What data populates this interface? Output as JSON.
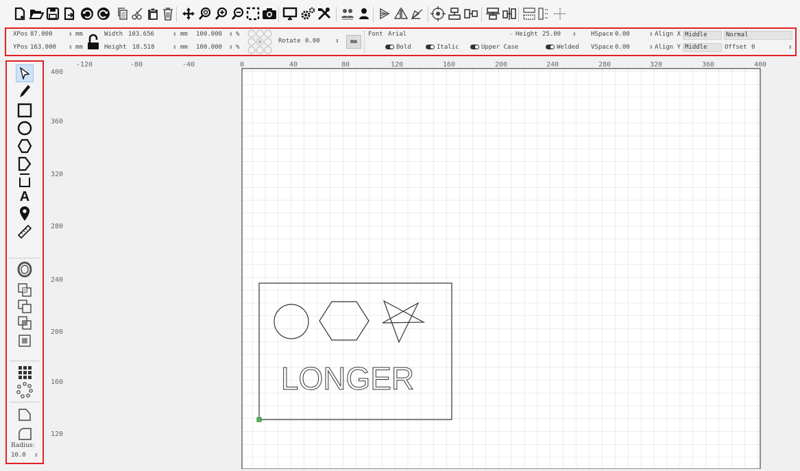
{
  "toolbar": {
    "icons": [
      "new-icon",
      "open-icon",
      "save-icon",
      "save-as-icon",
      "undo-icon",
      "redo-icon",
      "copy-icon",
      "cut-icon",
      "paste-icon",
      "delete-icon",
      "move-icon",
      "zoom-fit-icon",
      "zoom-in-icon",
      "zoom-out-icon",
      "select-frame-icon",
      "camera-icon",
      "monitor-icon",
      "machine-settings-icon",
      "tools-icon",
      "group-icon",
      "ungroup-icon",
      "mirror-h-icon",
      "mirror-v-icon",
      "rotate-icon",
      "center-icon",
      "align-icon",
      "distribute-icon",
      "dock-icon",
      "arrange-icon",
      "grid-icon",
      "crosshair-icon"
    ]
  },
  "props": {
    "xpos_label": "XPos",
    "xpos": "87.000",
    "ypos_label": "YPos",
    "ypos": "163.000",
    "unit_mm": "mm",
    "width_label": "Width",
    "width": "103.656",
    "height_label": "Height",
    "height": "18.518",
    "scale_x": "100.000",
    "scale_y": "100.000",
    "percent": "%",
    "rotate_label": "Rotate",
    "rotate": "0.00",
    "mm_btn": "mm",
    "font_label": "Font",
    "font": "Arial",
    "text_height_label": "Height",
    "text_height": "25.00",
    "hspace_label": "HSpace",
    "hspace": "0.00",
    "vspace_label": "VSpace",
    "vspace": "0.00",
    "align_x_label": "Align X",
    "align_x": "Middle",
    "align_y_label": "Align Y",
    "align_y": "Middle",
    "style": "Normal",
    "offset_label": "Offset",
    "offset": "0",
    "bold": "Bold",
    "italic": "Italic",
    "upper": "Upper Case",
    "welded": "Welded"
  },
  "left": {
    "radius_label": "Radius:",
    "radius": "10.0"
  },
  "ruler": {
    "x_ticks": [
      "-120",
      "-80",
      "-40",
      "0",
      "40",
      "80",
      "120",
      "160",
      "200",
      "240",
      "280",
      "320",
      "360",
      "400"
    ],
    "y_ticks": [
      "400",
      "360",
      "320",
      "280",
      "240",
      "200",
      "160",
      "120"
    ]
  },
  "design": {
    "text": "LONGER"
  }
}
